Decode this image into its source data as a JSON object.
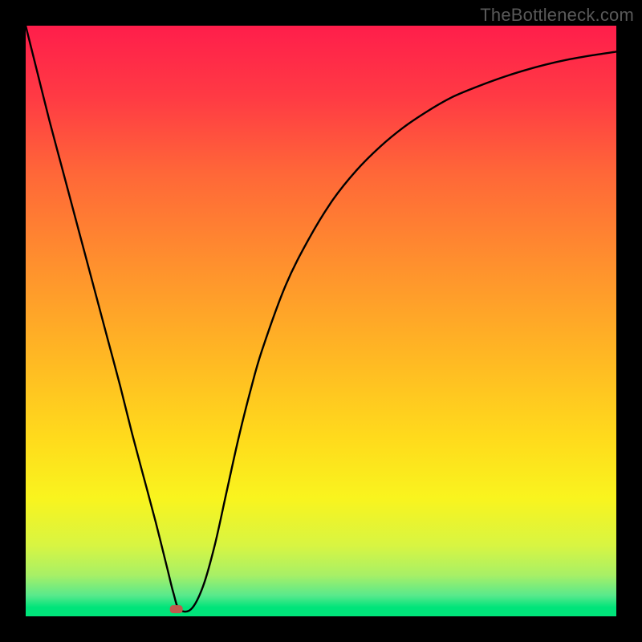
{
  "watermark": "TheBottleneck.com",
  "chart_data": {
    "type": "line",
    "title": "",
    "xlabel": "",
    "ylabel": "",
    "xlim": [
      0,
      100
    ],
    "ylim": [
      0,
      100
    ],
    "grid": false,
    "legend": false,
    "series": [
      {
        "name": "bottleneck-curve",
        "x": [
          0,
          2,
          4,
          6,
          8,
          10,
          12,
          14,
          16,
          18,
          20,
          22,
          24,
          25,
          26,
          28,
          30,
          32,
          34,
          36,
          38,
          40,
          44,
          48,
          52,
          56,
          60,
          64,
          68,
          72,
          76,
          80,
          84,
          88,
          92,
          96,
          100
        ],
        "y": [
          100,
          92,
          84,
          76.5,
          69,
          61.5,
          54,
          46.5,
          39,
          31,
          23.5,
          16,
          8,
          4,
          1.2,
          1.2,
          5,
          12,
          21,
          30,
          38,
          45,
          56,
          64,
          70.5,
          75.5,
          79.5,
          82.8,
          85.5,
          87.8,
          89.5,
          91,
          92.3,
          93.4,
          94.3,
          95,
          95.6
        ]
      }
    ],
    "marker": {
      "name": "current-point",
      "x": 25.5,
      "y": 1.2,
      "color": "#C05A4D"
    },
    "gradient_stops": [
      {
        "offset": 0.0,
        "color": "#FF1E4B"
      },
      {
        "offset": 0.12,
        "color": "#FF3A44"
      },
      {
        "offset": 0.25,
        "color": "#FF6738"
      },
      {
        "offset": 0.4,
        "color": "#FF8F2E"
      },
      {
        "offset": 0.55,
        "color": "#FFB524"
      },
      {
        "offset": 0.7,
        "color": "#FFDB1C"
      },
      {
        "offset": 0.8,
        "color": "#F9F41E"
      },
      {
        "offset": 0.88,
        "color": "#D8F542"
      },
      {
        "offset": 0.93,
        "color": "#A8F066"
      },
      {
        "offset": 0.965,
        "color": "#57E98C"
      },
      {
        "offset": 0.985,
        "color": "#00E47A"
      },
      {
        "offset": 1.0,
        "color": "#00E47A"
      }
    ]
  }
}
